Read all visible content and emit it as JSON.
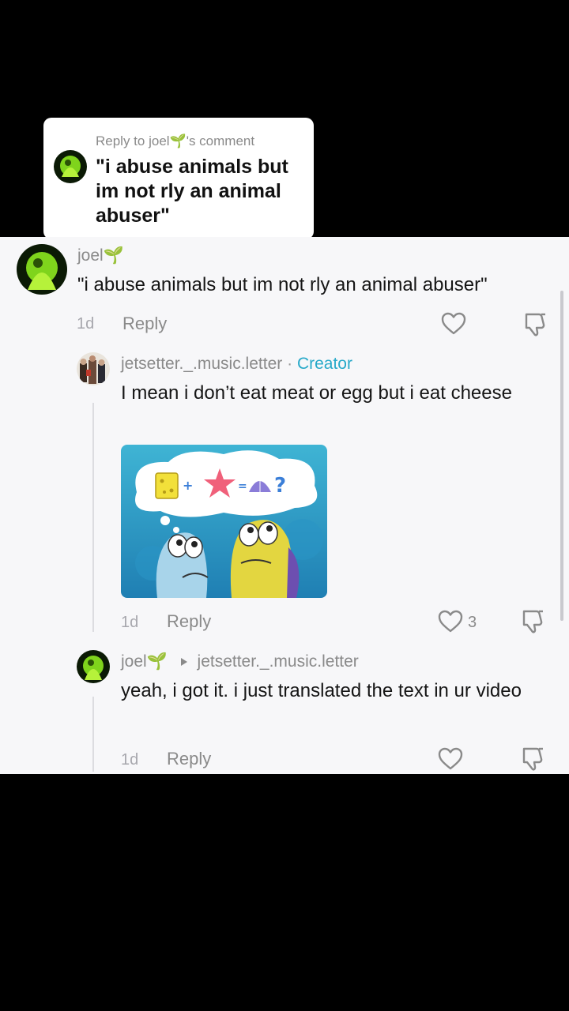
{
  "reply_sticker": {
    "header": "Reply to joel🌱's comment",
    "quote": "\"i abuse animals but im not rly an animal abuser\""
  },
  "comments": [
    {
      "username": "joel🌱",
      "text": "\"i abuse animals but im not rly an animal abuser\"",
      "time": "1d",
      "reply_label": "Reply",
      "likes": ""
    },
    {
      "username": "jetsetter._.music.letter",
      "separator": "·",
      "badge": "Creator",
      "text": "I mean i don’t eat meat or egg but i eat cheese",
      "time": "1d",
      "reply_label": "Reply",
      "likes": "3",
      "media_icon": "spongebob-fish-meme-image"
    },
    {
      "username": "joel🌱",
      "reply_to": "jetsetter._.music.letter",
      "text": "yeah, i got it. i just translated the text in ur video",
      "time": "1d",
      "reply_label": "Reply",
      "likes": ""
    }
  ],
  "colors": {
    "creator_badge": "#27a9c9",
    "panel_bg": "#f7f7f9",
    "backdrop": "#000000"
  },
  "icons": [
    "heart-outline-icon",
    "dislike-icon",
    "reply-arrow-icon"
  ]
}
